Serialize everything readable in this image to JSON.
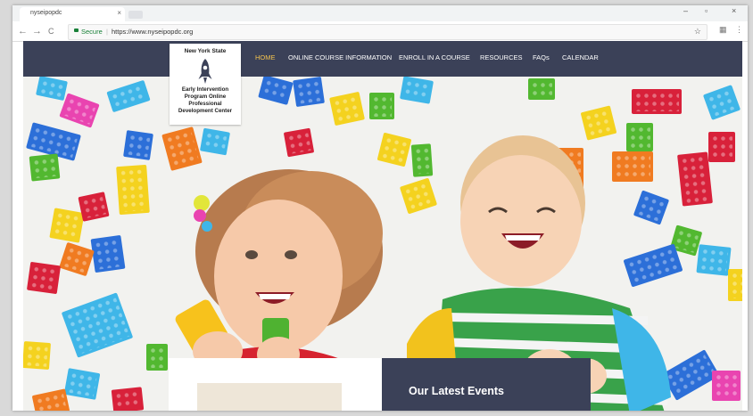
{
  "browser": {
    "tab_title": "nyseipopdc",
    "tab_close": "×",
    "secure_label": "Secure",
    "separator": "|",
    "url": "https://www.nyseipopdc.org",
    "back_glyph": "←",
    "forward_glyph": "→",
    "reload_glyph": "C",
    "star_glyph": "☆",
    "ext_glyph": "▦",
    "menu_glyph": "⋮",
    "min_glyph": "–",
    "max_glyph": "▫",
    "close_glyph": "×"
  },
  "logo": {
    "line1": "New York State",
    "line2": "Early Intervention Program Online Professional Development Center",
    "icon": "rocket-icon"
  },
  "nav": {
    "items": [
      "HOME",
      "ONLINE COURSE INFORMATION",
      "ENROLL IN A COURSE",
      "RESOURCES",
      "FAQs",
      "CALENDAR"
    ],
    "active_index": 0
  },
  "events": {
    "title": "Our Latest Events"
  },
  "colors": {
    "nav_bg": "#3b4158",
    "active_nav": "#f2c14e",
    "secure_green": "#188038"
  }
}
